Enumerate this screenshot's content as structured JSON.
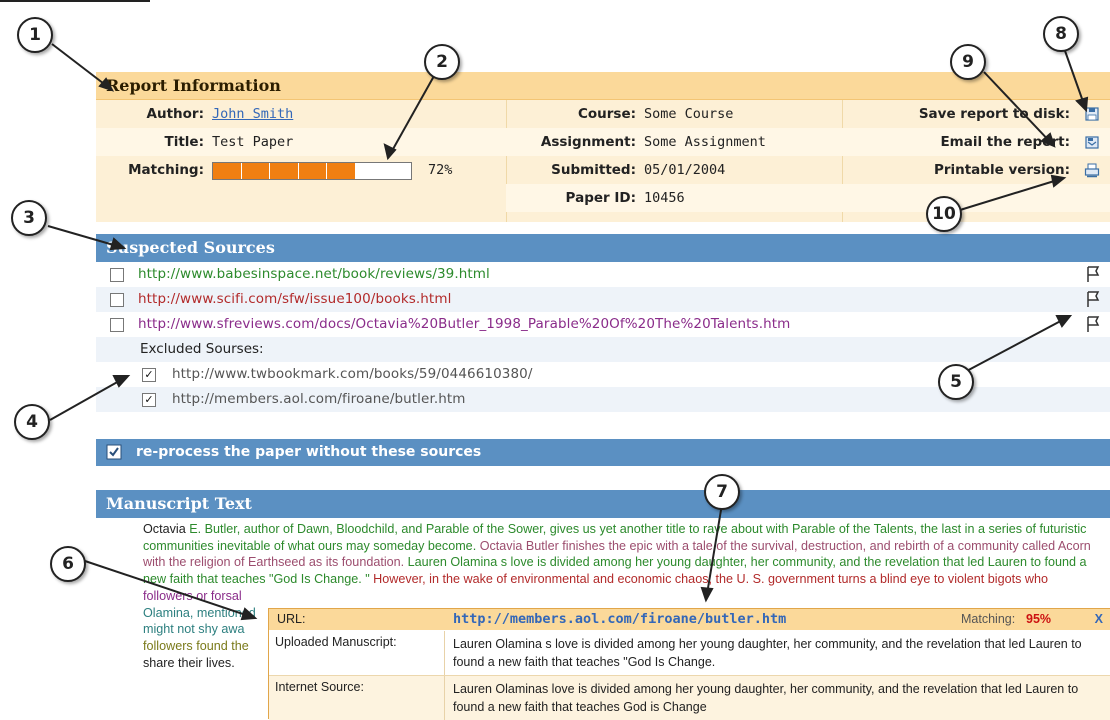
{
  "callouts": [
    "1",
    "2",
    "3",
    "4",
    "5",
    "6",
    "7",
    "8",
    "9",
    "10"
  ],
  "report": {
    "title": "Report Information",
    "author_label": "Author:",
    "author": "John Smith",
    "title_label": "Title:",
    "paper_title": "Test Paper",
    "matching_label": "Matching:",
    "matching": "72%",
    "matching_fraction": 0.72,
    "course_label": "Course:",
    "course": "Some Course",
    "assignment_label": "Assignment:",
    "assignment": "Some Assignment",
    "submitted_label": "Submitted:",
    "submitted": "05/01/2004",
    "paperid_label": "Paper ID:",
    "paperid": "10456",
    "save_label": "Save report to disk:",
    "email_label": "Email the report:",
    "print_label": "Printable version:"
  },
  "sources": {
    "title": "Suspected Sources",
    "items": [
      {
        "url": "http://www.babesinspace.net/book/reviews/39.html",
        "color": "#2c8a2c"
      },
      {
        "url": "http://www.scifi.com/sfw/issue100/books.html",
        "color": "#b22a2a"
      },
      {
        "url": "http://www.sfreviews.com/docs/Octavia%20Butler_1998_Parable%20Of%20The%20Talents.htm",
        "color": "#8a2c8a"
      }
    ],
    "excluded_label": "Excluded Sourses:",
    "excluded": [
      "http://www.twbookmark.com/books/59/0446610380/",
      "http://members.aol.com/firoane/butler.htm"
    ],
    "reprocess": "re-process the paper without these sources"
  },
  "manuscript": {
    "title": "Manuscript Text",
    "s1a": "Octavia ",
    "s1b": "E. Butler, author of Dawn, Bloodchild, and Parable of the Sower, gives us yet another title to rave about with Parable of the Talents, the last in a series of futuristic communities inevitable of what ours may someday become. ",
    "s2": "Octavia Butler finishes the epic with a tale of the survival, destruction, and rebirth of a community called Acorn with the religion of Earthseed as its foundation. ",
    "s3": "Lauren Olamina s love is divided among her young daughter, her community, and the revelation that led Lauren to found a new faith that teaches \"God Is Change. \" ",
    "s4": "However, in the wake of environmental and economic chaos, the U. S. government turns a blind eye to violent bigots who",
    "s5": "followers or forsal",
    "s6": "Olamina, mentioned",
    "s7": "might not shy awa",
    "s8": "followers found the",
    "s9": "share their lives."
  },
  "popup": {
    "url_label": "URL:",
    "url": "http://members.aol.com/firoane/butler.htm",
    "matching_label": "Matching:",
    "matching": "95%",
    "close": "X",
    "uploaded_label": "Uploaded Manuscript:",
    "uploaded_text": "Lauren Olamina s love is divided among her young daughter, her community, and the revelation that led Lauren to found a new faith that teaches \"God Is Change.",
    "internet_label": "Internet Source:",
    "internet_text": "Lauren Olaminas love is divided among her young daughter, her community, and the revelation that led Lauren to found a new faith that teaches God is Change"
  }
}
